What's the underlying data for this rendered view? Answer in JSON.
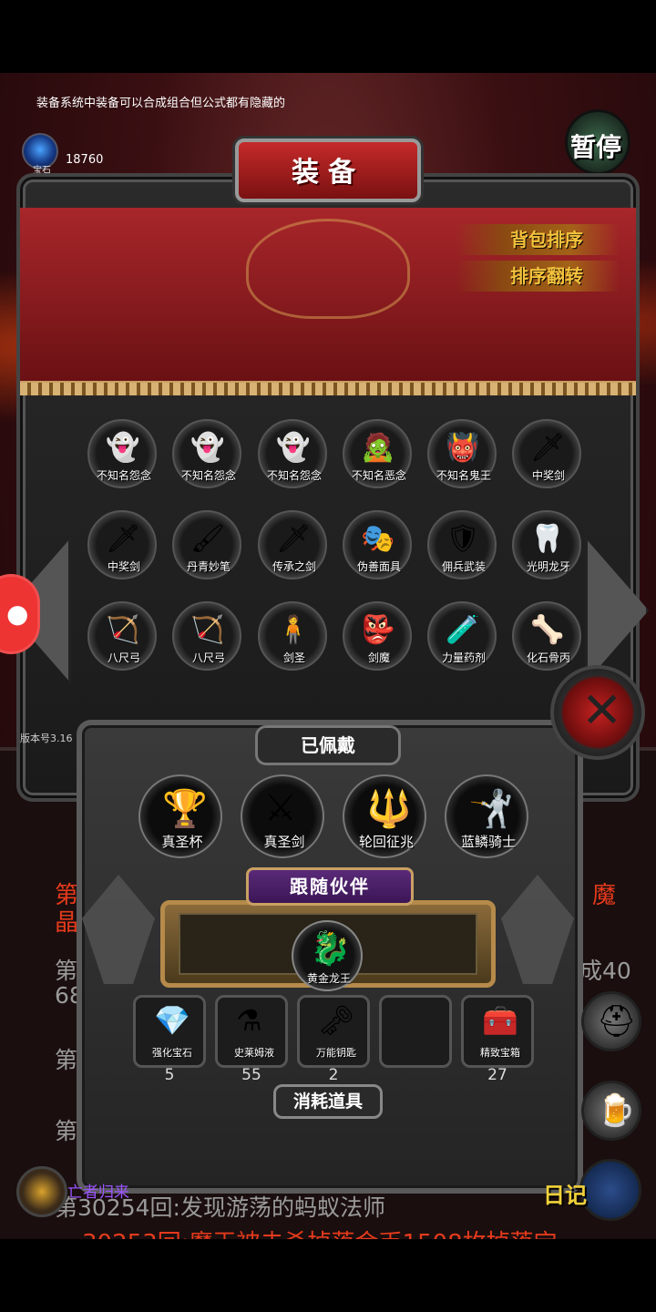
{
  "top_tip": "装备系统中装备可以合成组合但公式都有隐藏的",
  "gem": {
    "label": "宝石",
    "count": "18760"
  },
  "pause_label": "暂停",
  "panel_title": "装备",
  "sort_buttons": [
    "背包排序",
    "排序翻转"
  ],
  "inventory": [
    {
      "label": "不知名怨念",
      "icon": "ghost-icon",
      "glyph": "👻"
    },
    {
      "label": "不知名怨念",
      "icon": "ghost-icon",
      "glyph": "👻"
    },
    {
      "label": "不知名怨念",
      "icon": "ghost-icon",
      "glyph": "👻"
    },
    {
      "label": "不知名恶念",
      "icon": "wraith-icon",
      "glyph": "🧟"
    },
    {
      "label": "不知名鬼王",
      "icon": "ghost-king-icon",
      "glyph": "👹"
    },
    {
      "label": "中奖剑",
      "icon": "sword-icon",
      "glyph": "🗡"
    },
    {
      "label": "中奖剑",
      "icon": "sword-icon",
      "glyph": "🗡"
    },
    {
      "label": "丹青妙笔",
      "icon": "brush-icon",
      "glyph": "🖌"
    },
    {
      "label": "传承之剑",
      "icon": "sword-icon",
      "glyph": "🗡"
    },
    {
      "label": "伪善面具",
      "icon": "mask-icon",
      "glyph": "🎭"
    },
    {
      "label": "佣兵武装",
      "icon": "armor-icon",
      "glyph": "🛡"
    },
    {
      "label": "光明龙牙",
      "icon": "fang-icon",
      "glyph": "🦷"
    },
    {
      "label": "八尺弓",
      "icon": "bow-icon",
      "glyph": "🏹"
    },
    {
      "label": "八尺弓",
      "icon": "bow-icon",
      "glyph": "🏹"
    },
    {
      "label": "剑圣",
      "icon": "swordsaint-icon",
      "glyph": "🧍"
    },
    {
      "label": "剑魔",
      "icon": "sworddemon-icon",
      "glyph": "👺"
    },
    {
      "label": "力量药剂",
      "icon": "potion-icon",
      "glyph": "🧪"
    },
    {
      "label": "化石骨丙",
      "icon": "bone-icon",
      "glyph": "🦴"
    }
  ],
  "version": "版本号3.16",
  "equipped_header": "已佩戴",
  "equipped": [
    {
      "label": "真圣杯",
      "icon": "grail-icon",
      "glyph": "🏆"
    },
    {
      "label": "真圣剑",
      "icon": "holy-sword-icon",
      "glyph": "⚔"
    },
    {
      "label": "轮回征兆",
      "icon": "staff-icon",
      "glyph": "🔱"
    },
    {
      "label": "蓝鳞骑士",
      "icon": "knight-icon",
      "glyph": "🤺"
    }
  ],
  "pet_header": "跟随伙伴",
  "pet": {
    "label": "黄金龙王",
    "icon": "golden-dragon-icon",
    "glyph": "🐉"
  },
  "consumables_header": "消耗道具",
  "consumables": [
    {
      "label": "强化宝石",
      "count": "5",
      "icon": "gem-cluster-icon",
      "glyph": "💎"
    },
    {
      "label": "史莱姆液",
      "count": "55",
      "icon": "flask-icon",
      "glyph": "⚗"
    },
    {
      "label": "万能钥匙",
      "count": "2",
      "icon": "key-icon",
      "glyph": "🗝"
    },
    {
      "label": "",
      "count": "",
      "icon": "empty-slot",
      "glyph": ""
    },
    {
      "label": "精致宝箱",
      "count": "27",
      "icon": "chest-icon",
      "glyph": "🧰"
    }
  ],
  "log": {
    "line_a": "第30254回:发现游荡的蚂蚁法师",
    "line_b": "30253回:魔王被击杀掉落金币1508枚掉落宝",
    "frag_1": "第",
    "frag_2": "魔",
    "frag_3": "晶",
    "frag_4": "第",
    "frag_5": "成40",
    "frag_6": "68",
    "frag_7": "第",
    "frag_8": "第"
  },
  "avatar_label": "亡者归来",
  "diary_label": "日记",
  "colors": {
    "accent_red": "#c42121",
    "gold": "#f3c23c",
    "log_red": "#e43a1c"
  }
}
